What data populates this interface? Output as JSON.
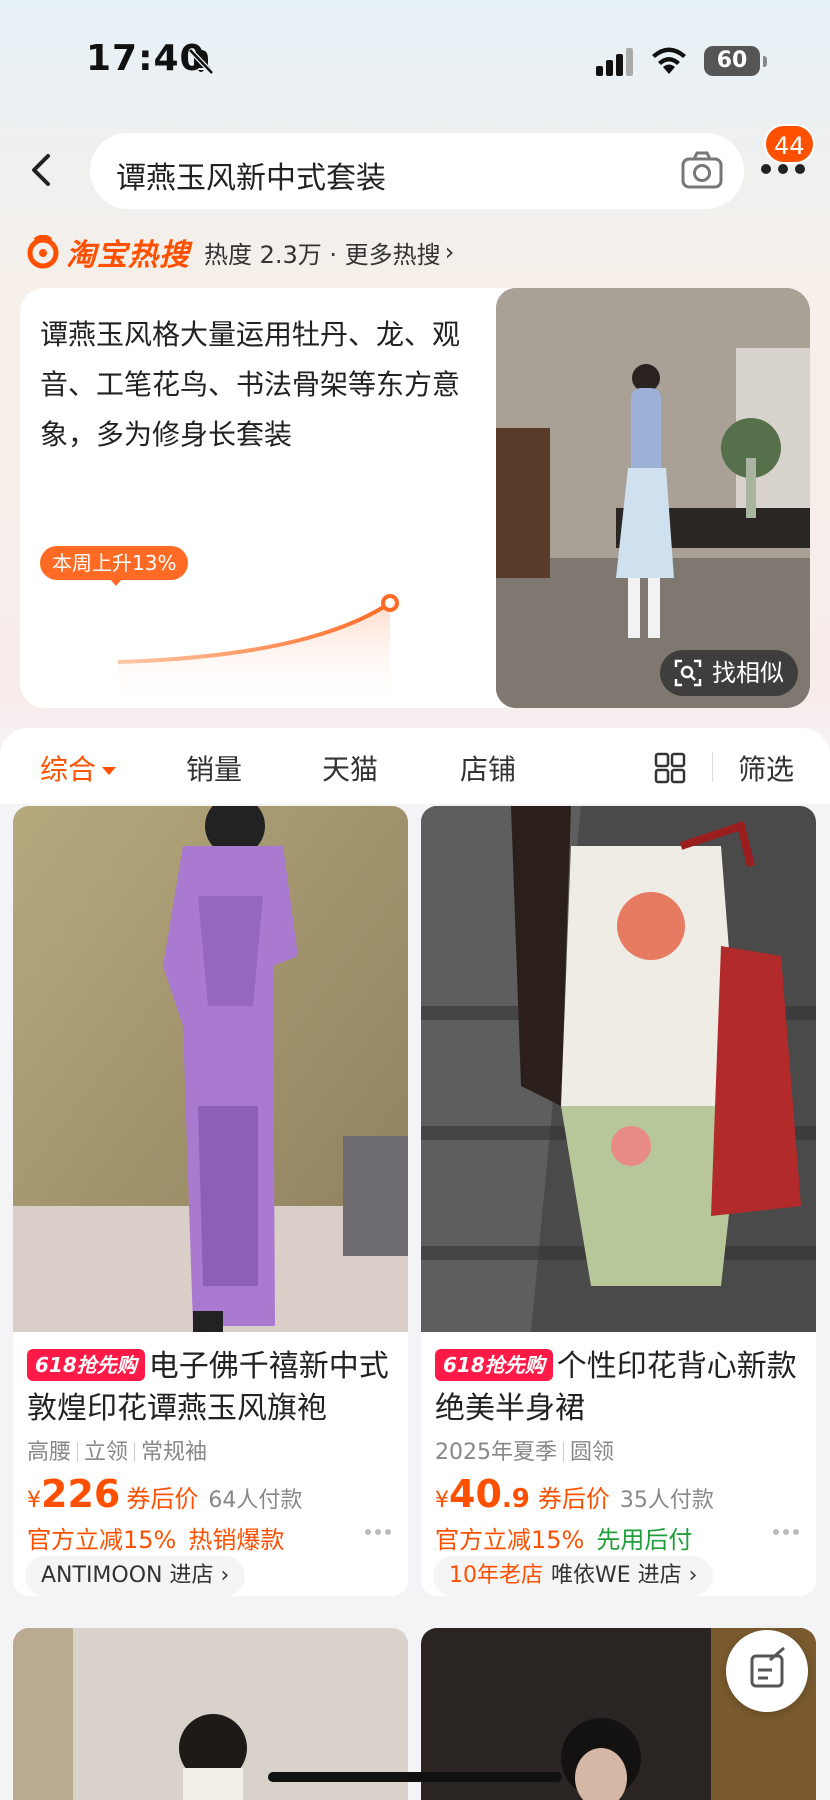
{
  "status_bar": {
    "time": "17:40",
    "battery": "60"
  },
  "header": {
    "search_query": "谭燕玉风新中式套装",
    "cart_badge": "44"
  },
  "hot_search": {
    "brand": "淘宝热搜",
    "heat": "热度 2.3万 · 更多热搜",
    "description": "谭燕玉风格大量运用牡丹、龙、观音、工笔花鸟、书法骨架等东方意象，多为修身长套装",
    "trend": "本周上升13%",
    "find_similar": "找相似"
  },
  "sort_bar": {
    "items": [
      "综合",
      "销量",
      "天猫",
      "店铺"
    ],
    "filter": "筛选"
  },
  "products": [
    {
      "tag": "618抢先购",
      "title": "电子佛千禧新中式敦煌印花谭燕玉风旗袍",
      "attrs": [
        "高腰",
        "立领",
        "常规袖"
      ],
      "yen": "¥",
      "price_int": "226",
      "price_dec": "",
      "after_coupon": "券后价",
      "paid": "64人付款",
      "promo1": "官方立减15%",
      "promo2": "热销爆款",
      "store_prefix": "",
      "store": "ANTIMOON 进店 ›"
    },
    {
      "tag": "618抢先购",
      "title": "个性印花背心新款绝美半身裙",
      "attrs": [
        "2025年夏季",
        "圆领"
      ],
      "yen": "¥",
      "price_int": "40",
      "price_dec": ".9",
      "after_coupon": "券后价",
      "paid": "35人付款",
      "promo1": "官方立减15%",
      "promo2": "先用后付",
      "store_prefix": "10年老店",
      "store": "唯依WE 进店 ›"
    }
  ],
  "colors": {
    "accent": "#ff5000",
    "tag618": "#ff1a47",
    "green": "#1f9e3a"
  }
}
